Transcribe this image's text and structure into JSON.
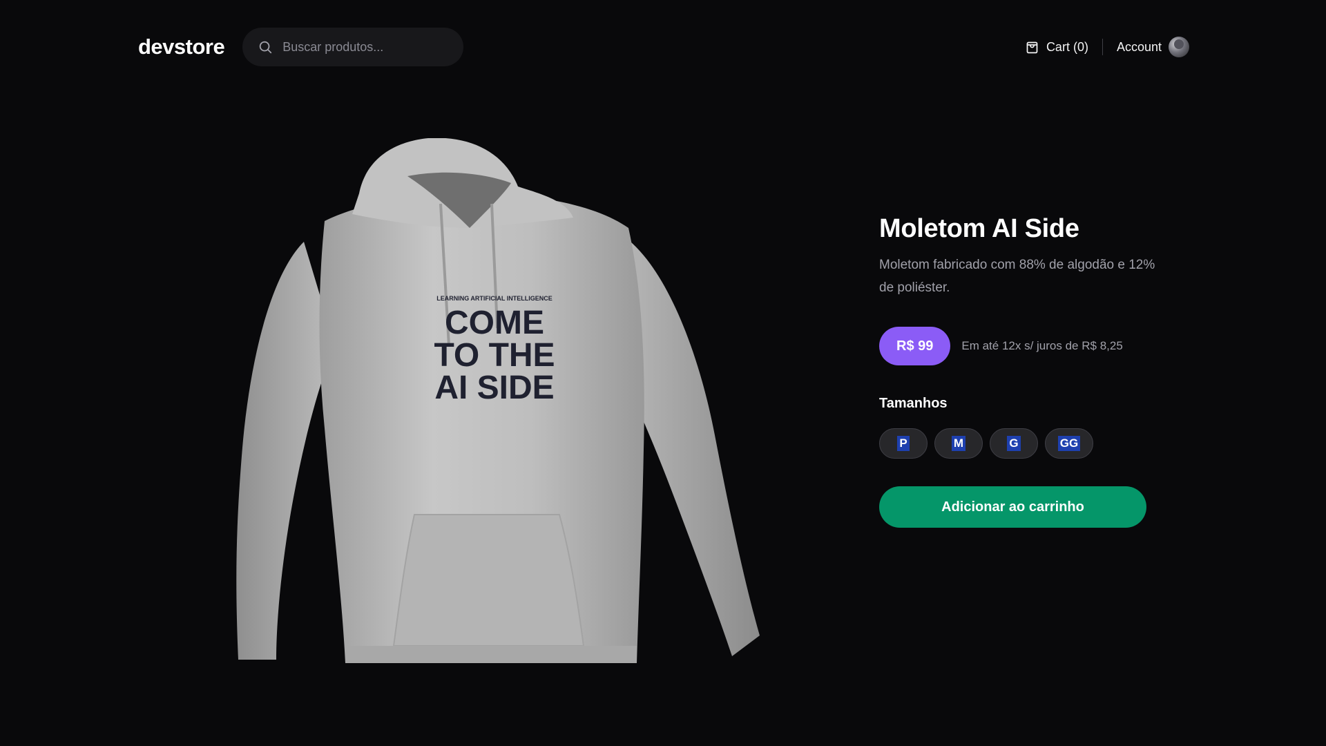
{
  "header": {
    "logo": "devstore",
    "search_placeholder": "Buscar produtos...",
    "cart_label": "Cart (0)",
    "account_label": "Account"
  },
  "product": {
    "title": "Moletom AI Side",
    "description": "Moletom fabricado com 88% de algodão e 12% de poliéster.",
    "price": "R$ 99",
    "installments": "Em até 12x s/ juros de R$ 8,25",
    "sizes_label": "Tamanhos",
    "sizes": [
      "P",
      "M",
      "G",
      "GG"
    ],
    "add_to_cart": "Adicionar ao carrinho",
    "print": {
      "top_line": "LEARNING ARTIFICIAL INTELLIGENCE",
      "line1": "COME",
      "line2": "TO THE",
      "line3": "AI SIDE"
    }
  },
  "colors": {
    "background": "#09090b",
    "price_badge": "#8b5cf6",
    "add_button": "#059669",
    "hoodie": "#bdbdbd"
  }
}
